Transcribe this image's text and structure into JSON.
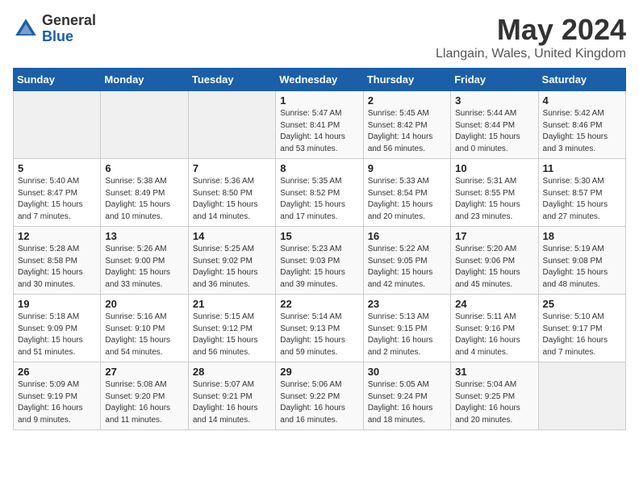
{
  "header": {
    "logo_general": "General",
    "logo_blue": "Blue",
    "month": "May 2024",
    "location": "Llangain, Wales, United Kingdom"
  },
  "weekdays": [
    "Sunday",
    "Monday",
    "Tuesday",
    "Wednesday",
    "Thursday",
    "Friday",
    "Saturday"
  ],
  "weeks": [
    [
      {
        "day": "",
        "info": ""
      },
      {
        "day": "",
        "info": ""
      },
      {
        "day": "",
        "info": ""
      },
      {
        "day": "1",
        "info": "Sunrise: 5:47 AM\nSunset: 8:41 PM\nDaylight: 14 hours and 53 minutes."
      },
      {
        "day": "2",
        "info": "Sunrise: 5:45 AM\nSunset: 8:42 PM\nDaylight: 14 hours and 56 minutes."
      },
      {
        "day": "3",
        "info": "Sunrise: 5:44 AM\nSunset: 8:44 PM\nDaylight: 15 hours and 0 minutes."
      },
      {
        "day": "4",
        "info": "Sunrise: 5:42 AM\nSunset: 8:46 PM\nDaylight: 15 hours and 3 minutes."
      }
    ],
    [
      {
        "day": "5",
        "info": "Sunrise: 5:40 AM\nSunset: 8:47 PM\nDaylight: 15 hours and 7 minutes."
      },
      {
        "day": "6",
        "info": "Sunrise: 5:38 AM\nSunset: 8:49 PM\nDaylight: 15 hours and 10 minutes."
      },
      {
        "day": "7",
        "info": "Sunrise: 5:36 AM\nSunset: 8:50 PM\nDaylight: 15 hours and 14 minutes."
      },
      {
        "day": "8",
        "info": "Sunrise: 5:35 AM\nSunset: 8:52 PM\nDaylight: 15 hours and 17 minutes."
      },
      {
        "day": "9",
        "info": "Sunrise: 5:33 AM\nSunset: 8:54 PM\nDaylight: 15 hours and 20 minutes."
      },
      {
        "day": "10",
        "info": "Sunrise: 5:31 AM\nSunset: 8:55 PM\nDaylight: 15 hours and 23 minutes."
      },
      {
        "day": "11",
        "info": "Sunrise: 5:30 AM\nSunset: 8:57 PM\nDaylight: 15 hours and 27 minutes."
      }
    ],
    [
      {
        "day": "12",
        "info": "Sunrise: 5:28 AM\nSunset: 8:58 PM\nDaylight: 15 hours and 30 minutes."
      },
      {
        "day": "13",
        "info": "Sunrise: 5:26 AM\nSunset: 9:00 PM\nDaylight: 15 hours and 33 minutes."
      },
      {
        "day": "14",
        "info": "Sunrise: 5:25 AM\nSunset: 9:02 PM\nDaylight: 15 hours and 36 minutes."
      },
      {
        "day": "15",
        "info": "Sunrise: 5:23 AM\nSunset: 9:03 PM\nDaylight: 15 hours and 39 minutes."
      },
      {
        "day": "16",
        "info": "Sunrise: 5:22 AM\nSunset: 9:05 PM\nDaylight: 15 hours and 42 minutes."
      },
      {
        "day": "17",
        "info": "Sunrise: 5:20 AM\nSunset: 9:06 PM\nDaylight: 15 hours and 45 minutes."
      },
      {
        "day": "18",
        "info": "Sunrise: 5:19 AM\nSunset: 9:08 PM\nDaylight: 15 hours and 48 minutes."
      }
    ],
    [
      {
        "day": "19",
        "info": "Sunrise: 5:18 AM\nSunset: 9:09 PM\nDaylight: 15 hours and 51 minutes."
      },
      {
        "day": "20",
        "info": "Sunrise: 5:16 AM\nSunset: 9:10 PM\nDaylight: 15 hours and 54 minutes."
      },
      {
        "day": "21",
        "info": "Sunrise: 5:15 AM\nSunset: 9:12 PM\nDaylight: 15 hours and 56 minutes."
      },
      {
        "day": "22",
        "info": "Sunrise: 5:14 AM\nSunset: 9:13 PM\nDaylight: 15 hours and 59 minutes."
      },
      {
        "day": "23",
        "info": "Sunrise: 5:13 AM\nSunset: 9:15 PM\nDaylight: 16 hours and 2 minutes."
      },
      {
        "day": "24",
        "info": "Sunrise: 5:11 AM\nSunset: 9:16 PM\nDaylight: 16 hours and 4 minutes."
      },
      {
        "day": "25",
        "info": "Sunrise: 5:10 AM\nSunset: 9:17 PM\nDaylight: 16 hours and 7 minutes."
      }
    ],
    [
      {
        "day": "26",
        "info": "Sunrise: 5:09 AM\nSunset: 9:19 PM\nDaylight: 16 hours and 9 minutes."
      },
      {
        "day": "27",
        "info": "Sunrise: 5:08 AM\nSunset: 9:20 PM\nDaylight: 16 hours and 11 minutes."
      },
      {
        "day": "28",
        "info": "Sunrise: 5:07 AM\nSunset: 9:21 PM\nDaylight: 16 hours and 14 minutes."
      },
      {
        "day": "29",
        "info": "Sunrise: 5:06 AM\nSunset: 9:22 PM\nDaylight: 16 hours and 16 minutes."
      },
      {
        "day": "30",
        "info": "Sunrise: 5:05 AM\nSunset: 9:24 PM\nDaylight: 16 hours and 18 minutes."
      },
      {
        "day": "31",
        "info": "Sunrise: 5:04 AM\nSunset: 9:25 PM\nDaylight: 16 hours and 20 minutes."
      },
      {
        "day": "",
        "info": ""
      }
    ]
  ]
}
